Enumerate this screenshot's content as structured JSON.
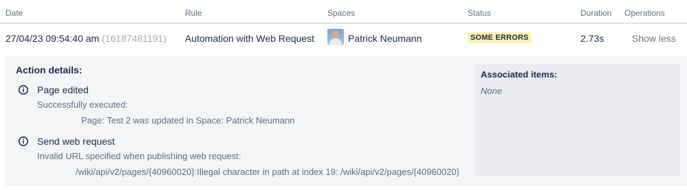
{
  "columns": {
    "date": "Date",
    "rule": "Rule",
    "spaces": "Spaces",
    "status": "Status",
    "duration": "Duration",
    "operations": "Operations"
  },
  "row": {
    "date": "27/04/23 09:54:40 am",
    "id": "(16187481191)",
    "rule": "Automation with Web Request",
    "space_name": "Patrick Neumann",
    "status": "SOME ERRORS",
    "duration": "2.73s",
    "operation": "Show less"
  },
  "details": {
    "title": "Action details:",
    "actions": [
      {
        "title": "Page edited",
        "status": "Successfully executed:",
        "message": "Page: Test 2 was updated in Space: Patrick Neumann",
        "icon": "info-icon"
      },
      {
        "title": "Send web request",
        "status": "Invalid URL specified when publishing web request:",
        "message": "/wiki/api/v2/pages/{40960020}:Illegal character in path at index 19: /wiki/api/v2/pages/{40960020}",
        "icon": "info-icon"
      }
    ]
  },
  "associated": {
    "title": "Associated items:",
    "value": "None"
  },
  "colors": {
    "status_bg": "#fff0b3",
    "panel_bg": "#f4f5f7",
    "assoc_bg": "#ebecf0",
    "text": "#172b4d",
    "subtle_text": "#5e6c84"
  }
}
